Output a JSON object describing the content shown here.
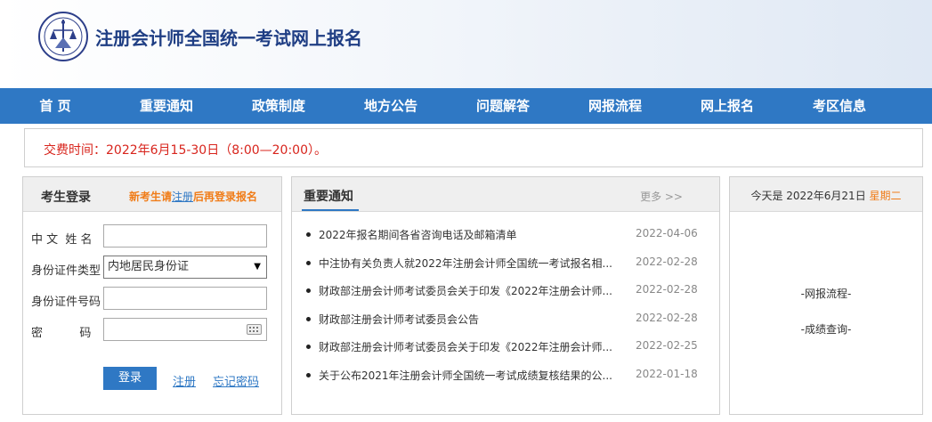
{
  "site": {
    "title": "注册会计师全国统一考试网上报名"
  },
  "nav": [
    "首 页",
    "重要通知",
    "政策制度",
    "地方公告",
    "问题解答",
    "网报流程",
    "网上报名",
    "考区信息"
  ],
  "notice": {
    "text": "交费时间：2022年6月15-30日（8:00—20:00）。"
  },
  "login": {
    "title": "考生登录",
    "hint_prefix": "新考生请",
    "hint_link": "注册",
    "hint_suffix": "后再登录报名",
    "name_label": "中 文  姓 名",
    "name_value": "",
    "id_type_label": "身份证件类型",
    "id_type_value": "内地居民身份证",
    "id_number_label": "身份证件号码",
    "id_number_value": "",
    "password_label": "密          码",
    "password_value": "",
    "login_button": "登录",
    "register_link": "注册",
    "forgot_link": "忘记密码"
  },
  "news": {
    "title": "重要通知",
    "more": "更多 >>",
    "items": [
      {
        "text": "2022年报名期间各省咨询电话及邮箱清单",
        "date": "2022-04-06"
      },
      {
        "text": "中注协有关负责人就2022年注册会计师全国统一考试报名相...",
        "date": "2022-02-28"
      },
      {
        "text": "财政部注册会计师考试委员会关于印发《2022年注册会计师...",
        "date": "2022-02-28"
      },
      {
        "text": "财政部注册会计师考试委员会公告",
        "date": "2022-02-28"
      },
      {
        "text": "财政部注册会计师考试委员会关于印发《2022年注册会计师...",
        "date": "2022-02-25"
      },
      {
        "text": "关于公布2021年注册会计师全国统一考试成绩复核结果的公...",
        "date": "2022-01-18"
      }
    ]
  },
  "side": {
    "today_prefix": "今天是 2022年6月21日",
    "weekday": "星期二",
    "link1": "-网报流程-",
    "link2": "-成绩查询-"
  },
  "icons": {
    "logo": "cicpa-emblem-icon",
    "keyboard": "keyboard-icon",
    "dropdown": "dropdown-arrow-icon"
  },
  "colors": {
    "nav": "#2f78c4",
    "title": "#1f3e84",
    "notice": "#d8251d",
    "accent": "#f07c18"
  }
}
